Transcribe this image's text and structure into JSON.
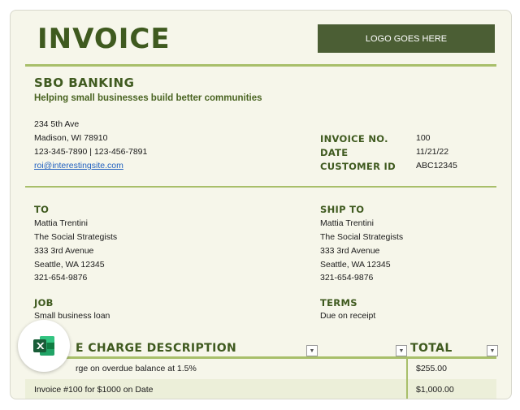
{
  "invoice": {
    "title": "INVOICE",
    "logo_placeholder": "LOGO GOES HERE"
  },
  "company": {
    "name": "SBO BANKING",
    "tagline": "Helping small businesses build better communities",
    "address1": "234 5th Ave",
    "address2": "Madison, WI 78910",
    "phones": "123-345-7890 | 123-456-7891",
    "email": "roi@interestingsite.com"
  },
  "meta": {
    "invoice_no_label": "INVOICE NO.",
    "invoice_no": "100",
    "date_label": "DATE",
    "date": "11/21/22",
    "customer_id_label": "CUSTOMER ID",
    "customer_id": "ABC12345"
  },
  "to": {
    "label": "TO",
    "name": "Mattia Trentini",
    "company": "The Social Strategists",
    "street": "333 3rd Avenue",
    "city": "Seattle, WA 12345",
    "phone": "321-654-9876"
  },
  "ship_to": {
    "label": "SHIP TO",
    "name": "Mattia Trentini",
    "company": "The Social Strategists",
    "street": "333 3rd Avenue",
    "city": "Seattle, WA 12345",
    "phone": "321-654-9876"
  },
  "job": {
    "label": "JOB",
    "value": "Small business loan"
  },
  "terms": {
    "label": "TERMS",
    "value": "Due on receipt"
  },
  "table": {
    "description_header": "E CHARGE DESCRIPTION",
    "total_header": "TOTAL",
    "rows": [
      {
        "description": "rge on overdue balance at 1.5%",
        "total": "$255.00"
      },
      {
        "description": "Invoice #100 for $1000 on Date",
        "total": "$1,000.00"
      }
    ]
  },
  "icons": {
    "filter_dropdown": "chevron-down-icon",
    "app_badge": "excel-icon"
  },
  "colors": {
    "accent": "#3f5a1f",
    "rule": "#a8bf6a",
    "logo_bg": "#4b5e34",
    "page_bg": "#f6f6ea",
    "excel_green": "#1e7145"
  }
}
